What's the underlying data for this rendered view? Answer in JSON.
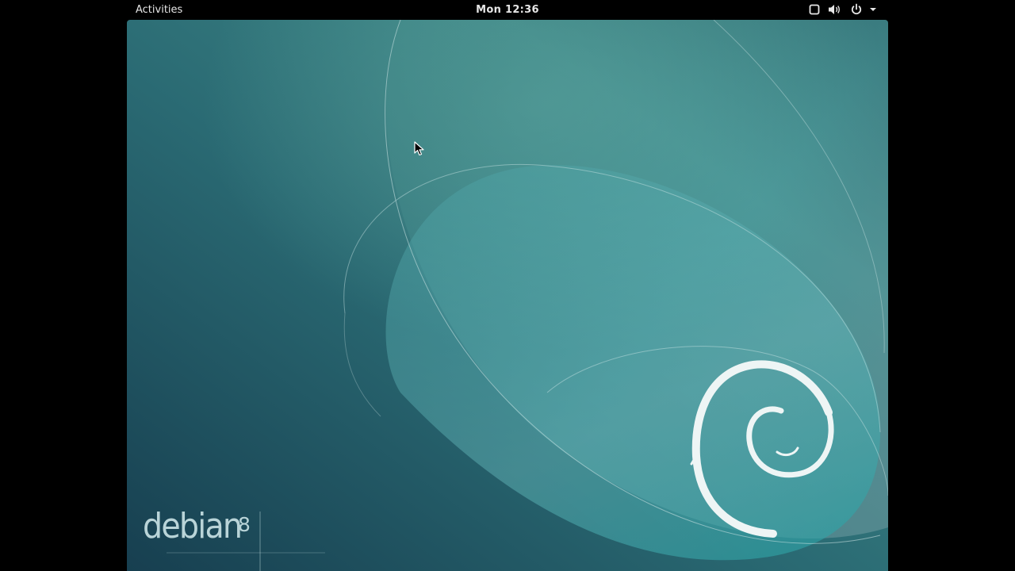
{
  "topbar": {
    "activities_label": "Activities",
    "clock": "Mon 12:36",
    "status_icons": [
      "screen-icon",
      "volume-icon",
      "power-icon",
      "menu-arrow-icon"
    ]
  },
  "desktop": {
    "brand_name": "debian",
    "brand_version": "8",
    "colors": {
      "background_dark": "#1b4a5a",
      "background_mid": "#2f7378",
      "swirl_fill": "#eef5f5",
      "highlight": "#5ab5b6"
    }
  }
}
